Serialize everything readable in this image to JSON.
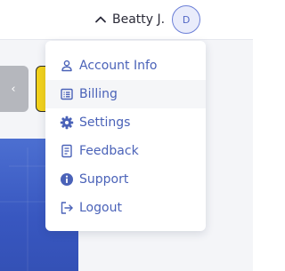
{
  "user": {
    "name": "Beatty J.",
    "avatar_initial": "D"
  },
  "page": {
    "back_button_glyph": "‹"
  },
  "menu": {
    "items": [
      {
        "label": "Account Info",
        "icon": "user-icon"
      },
      {
        "label": "Billing",
        "icon": "billing-icon"
      },
      {
        "label": "Settings",
        "icon": "gear-icon"
      },
      {
        "label": "Feedback",
        "icon": "feedback-icon"
      },
      {
        "label": "Support",
        "icon": "info-icon"
      },
      {
        "label": "Logout",
        "icon": "logout-icon"
      }
    ],
    "active_label": "Billing"
  },
  "colors": {
    "menu_text": "#4a62b8",
    "accent_yellow": "#f3d21b",
    "hero_blue": "#3f5fc8"
  }
}
